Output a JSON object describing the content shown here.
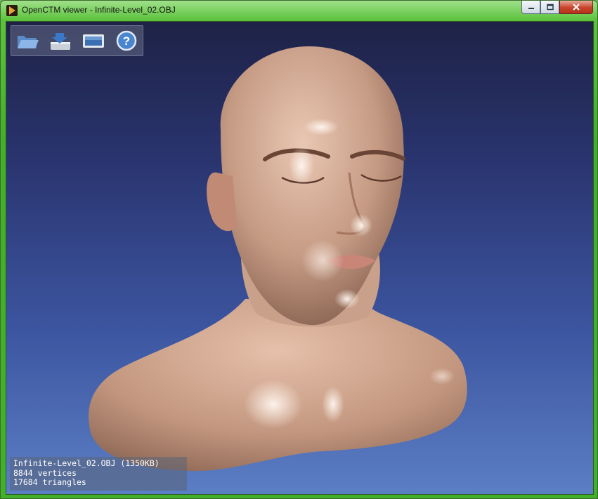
{
  "window": {
    "title": "OpenCTM viewer - Infinite-Level_02.OBJ",
    "app_icon": "play-triangle-icon"
  },
  "caption_buttons": {
    "minimize_icon": "minimize-icon",
    "maximize_icon": "maximize-icon",
    "close_icon": "close-icon"
  },
  "toolbar": {
    "items": [
      {
        "name": "open",
        "icon": "folder-open-icon"
      },
      {
        "name": "save",
        "icon": "save-download-icon"
      },
      {
        "name": "screenshot",
        "icon": "screen-icon"
      },
      {
        "name": "help",
        "icon": "question-icon"
      }
    ]
  },
  "info": {
    "file_line": "Infinite-Level_02.OBJ (1350KB)",
    "vertices_line": "8844 vertices",
    "triangles_line": "17684 triangles"
  },
  "colors": {
    "title_bar": "#5cc23c",
    "viewport_top": "#1e2246",
    "viewport_bottom": "#5b7ec4",
    "skin": "#c9a089"
  }
}
